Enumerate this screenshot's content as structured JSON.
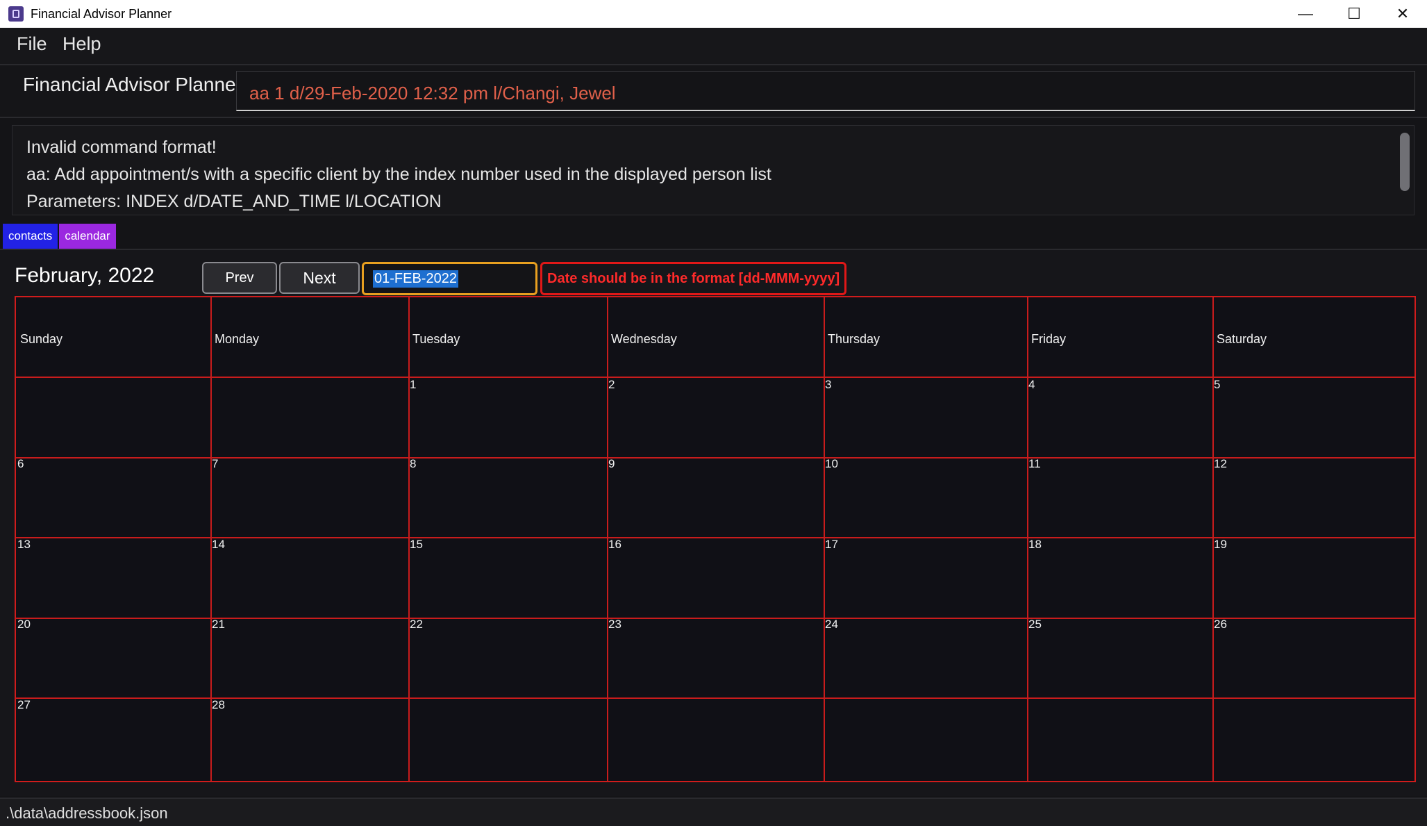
{
  "window": {
    "title": "Financial Advisor Planner",
    "minimize": "—",
    "maximize": "☐",
    "close": "✕"
  },
  "menu": {
    "file": "File",
    "help": "Help"
  },
  "header": {
    "app_label": "Financial Advisor Planner",
    "command_value": "aa 1 d/29-Feb-2020 12:32 pm l/Changi, Jewel"
  },
  "result": {
    "lines": [
      "Invalid command format!",
      "aa: Add appointment/s with a specific client by the index number used in the displayed person list",
      "Parameters: INDEX d/DATE_AND_TIME l/LOCATION"
    ]
  },
  "tabs": {
    "contacts": "contacts",
    "calendar": "calendar"
  },
  "calendar": {
    "month_label": "February, 2022",
    "prev_label": "Prev",
    "next_label": "Next",
    "date_value": "01-FEB-2022",
    "error": "Date should be in the format [dd-MMM-yyyy]",
    "days": [
      "Sunday",
      "Monday",
      "Tuesday",
      "Wednesday",
      "Thursday",
      "Friday",
      "Saturday"
    ],
    "weeks": [
      [
        "",
        "",
        "1",
        "2",
        "3",
        "4",
        "5"
      ],
      [
        "6",
        "7",
        "8",
        "9",
        "10",
        "11",
        "12"
      ],
      [
        "13",
        "14",
        "15",
        "16",
        "17",
        "18",
        "19"
      ],
      [
        "20",
        "21",
        "22",
        "23",
        "24",
        "25",
        "26"
      ],
      [
        "27",
        "28",
        "",
        "",
        "",
        "",
        ""
      ]
    ]
  },
  "status": {
    "path": ".\\data\\addressbook.json"
  },
  "colors": {
    "tab_contacts": "#2222e6",
    "tab_calendar": "#9b28e0",
    "grid_line": "#c81c1c",
    "error": "#ff2a2a",
    "command_text": "#e0604a"
  }
}
